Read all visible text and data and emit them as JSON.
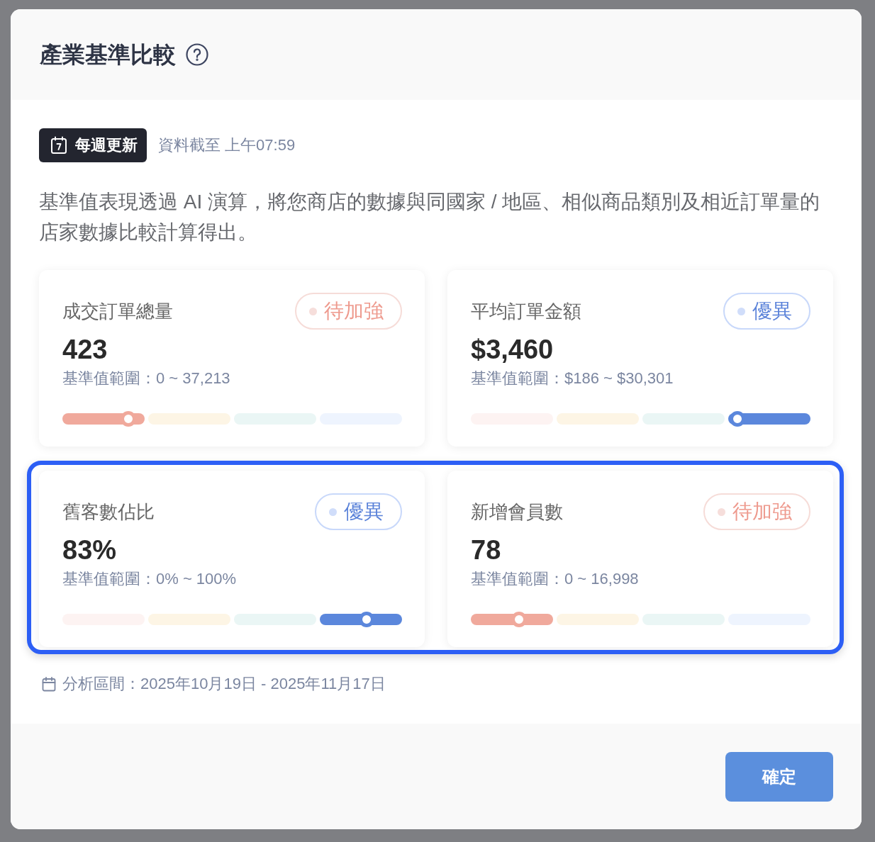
{
  "dialog": {
    "title": "產業基準比較"
  },
  "update_badge": {
    "label": "每週更新"
  },
  "data_as_of": "資料截至 上午07:59",
  "description": "基準值表現透過 AI 演算，將您商店的數據與同國家 / 地區、相似商品類別及相近訂單量的店家數據比較計算得出。",
  "cards": [
    {
      "title": "成交訂單總量",
      "value": "423",
      "range": "基準值範圍：0 ~ 37,213",
      "status": {
        "kind": "weak",
        "label": "待加強"
      },
      "level": 0.195,
      "highlighted": false
    },
    {
      "title": "平均訂單金額",
      "value": "$3,460",
      "range": "基準值範圍：$186 ~ $30,301",
      "status": {
        "kind": "excellent",
        "label": "優異"
      },
      "level": 0.785,
      "highlighted": false
    },
    {
      "title": "舊客數佔比",
      "value": "83%",
      "range": "基準值範圍：0% ~ 100%",
      "status": {
        "kind": "excellent",
        "label": "優異"
      },
      "level": 0.895,
      "highlighted": true
    },
    {
      "title": "新增會員數",
      "value": "78",
      "range": "基準值範圍：0 ~ 16,998",
      "status": {
        "kind": "weak",
        "label": "待加強"
      },
      "level": 0.142,
      "highlighted": true
    }
  ],
  "analysis_period": "分析區間：2025年10月19日 - 2025年11月17日",
  "buttons": [
    {
      "label": "確定"
    }
  ]
}
